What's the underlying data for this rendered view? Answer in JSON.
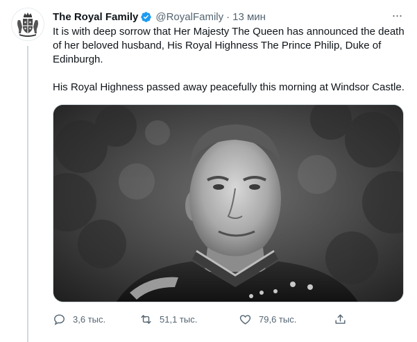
{
  "tweet": {
    "author_name": "The Royal Family",
    "handle": "@RoyalFamily",
    "separator": "·",
    "time": "13 мин",
    "more_label": "···",
    "paragraphs": [
      "It is with deep sorrow that Her Majesty The Queen has announced the death of her beloved husband, His Royal Highness The Prince Philip, Duke of Edinburgh.",
      "His Royal Highness passed away peacefully this morning at Windsor Castle."
    ],
    "media": {
      "kind": "black-and-white portrait photo"
    },
    "actions": {
      "replies": "3,6 тыс.",
      "retweets": "51,1 тыс.",
      "likes": "79,6 тыс."
    }
  },
  "colors": {
    "text_primary": "#0f1419",
    "text_secondary": "#536471",
    "verified_badge": "#1d9bf0",
    "thread_line": "#cfd9de"
  },
  "icons": {
    "avatar": "royal-coat-of-arms-icon",
    "verified": "verified-badge-icon",
    "more": "more-dots-icon",
    "reply": "reply-icon",
    "retweet": "retweet-icon",
    "like": "heart-icon",
    "share": "share-icon"
  }
}
